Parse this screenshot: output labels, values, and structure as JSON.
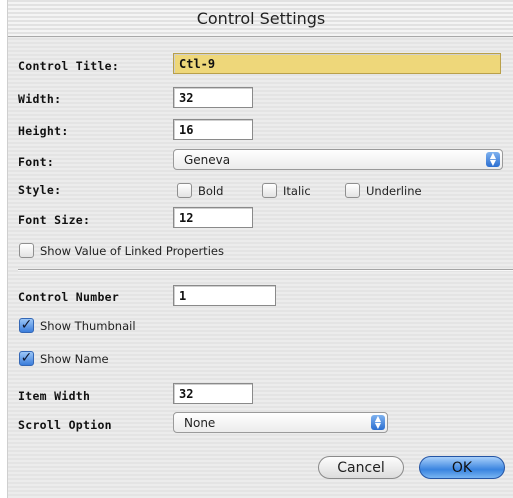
{
  "window": {
    "title": "Control Settings"
  },
  "control_title": {
    "label": "Control Title:",
    "value": "Ctl-9"
  },
  "width": {
    "label": "Width:",
    "value": "32"
  },
  "height": {
    "label": "Height:",
    "value": "16"
  },
  "font": {
    "label": "Font:",
    "value": "Geneva"
  },
  "style": {
    "label": "Style:",
    "bold": {
      "label": "Bold",
      "checked": false
    },
    "italic": {
      "label": "Italic",
      "checked": false
    },
    "underline": {
      "label": "Underline",
      "checked": false
    }
  },
  "font_size": {
    "label": "Font Size:",
    "value": "12"
  },
  "show_linked": {
    "label": "Show Value of Linked Properties",
    "checked": false
  },
  "control_number": {
    "label": "Control Number",
    "value": "1"
  },
  "show_thumbnail": {
    "label": "Show Thumbnail",
    "checked": true
  },
  "show_name": {
    "label": "Show Name",
    "checked": true
  },
  "item_width": {
    "label": "Item Width",
    "value": "32"
  },
  "scroll_option": {
    "label": "Scroll Option",
    "value": "None"
  },
  "buttons": {
    "cancel": "Cancel",
    "ok": "OK"
  },
  "colors": {
    "highlight_field": "#eed77a",
    "default_button": "#3a84e0",
    "checkbox_checked": "#3b7ddb"
  }
}
